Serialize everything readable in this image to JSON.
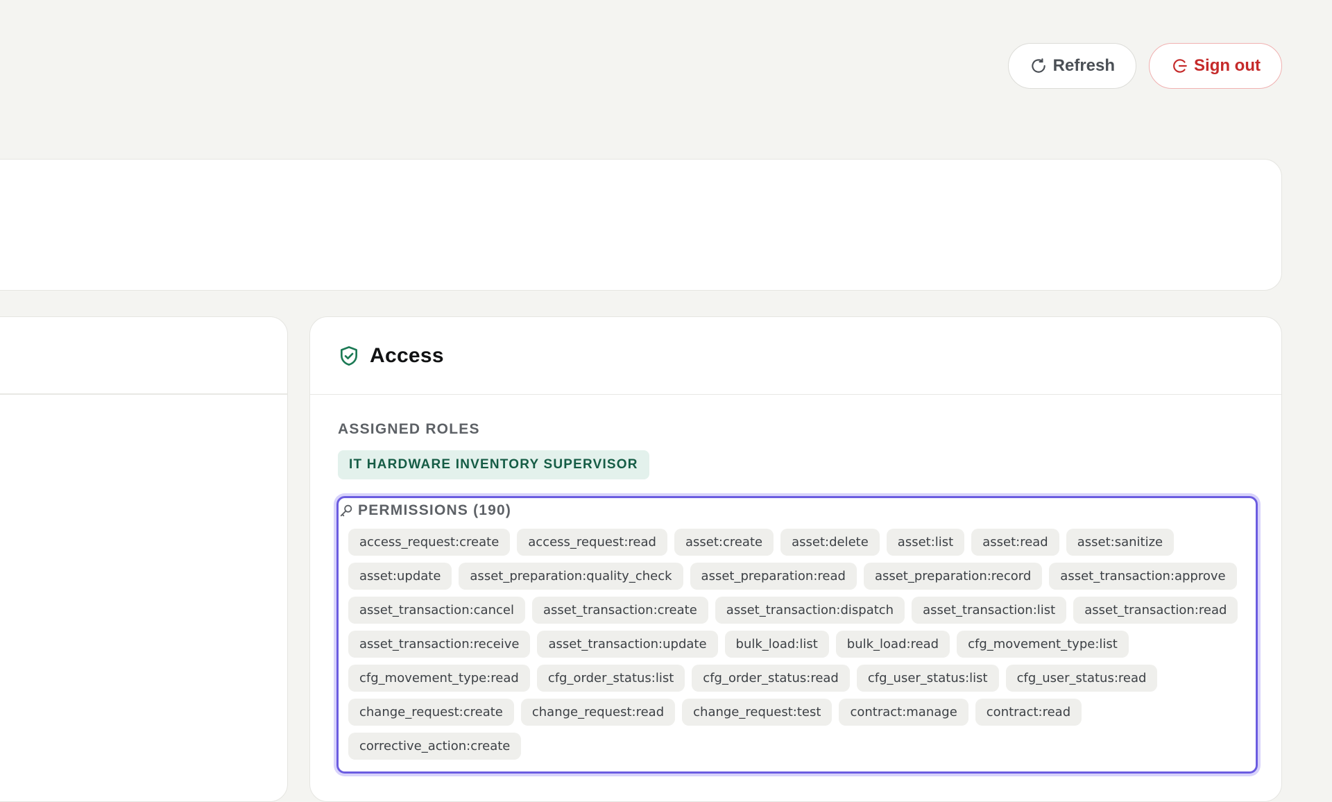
{
  "header": {
    "refresh_label": "Refresh",
    "signout_label": "Sign out"
  },
  "access": {
    "title": "Access",
    "assigned_roles_label": "ASSIGNED ROLES",
    "roles": [
      "IT HARDWARE INVENTORY SUPERVISOR"
    ],
    "permissions_label": "PERMISSIONS (190)",
    "permissions": [
      "access_request:create",
      "access_request:read",
      "asset:create",
      "asset:delete",
      "asset:list",
      "asset:read",
      "asset:sanitize",
      "asset:update",
      "asset_preparation:quality_check",
      "asset_preparation:read",
      "asset_preparation:record",
      "asset_transaction:approve",
      "asset_transaction:cancel",
      "asset_transaction:create",
      "asset_transaction:dispatch",
      "asset_transaction:list",
      "asset_transaction:read",
      "asset_transaction:receive",
      "asset_transaction:update",
      "bulk_load:list",
      "bulk_load:read",
      "cfg_movement_type:list",
      "cfg_movement_type:read",
      "cfg_order_status:list",
      "cfg_order_status:read",
      "cfg_user_status:list",
      "cfg_user_status:read",
      "change_request:create",
      "change_request:read",
      "change_request:test",
      "contract:manage",
      "contract:read",
      "corrective_action:create"
    ]
  },
  "colors": {
    "accent": "#6b5ce0",
    "danger": "#c52a2a",
    "role_badge_bg": "#e3f1ec",
    "role_badge_text": "#155c45",
    "shield_icon": "#1c7a55"
  }
}
